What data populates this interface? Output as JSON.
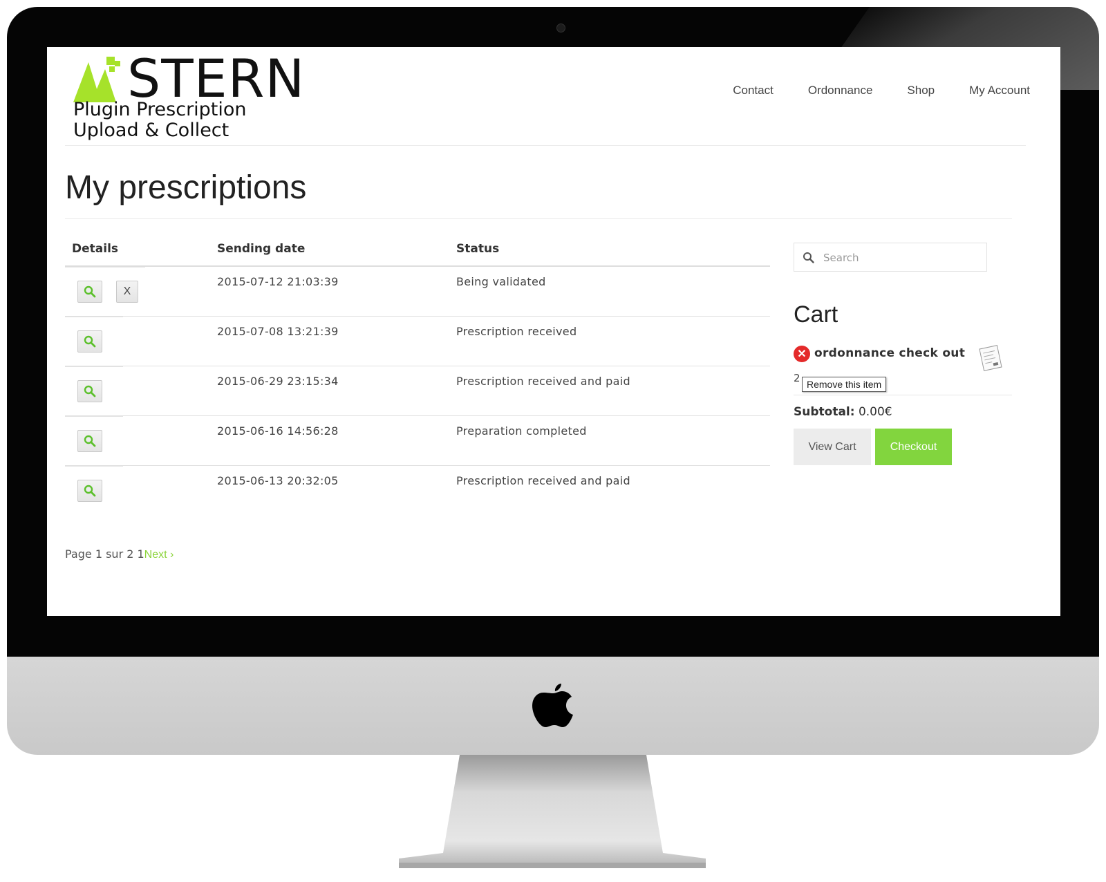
{
  "site": {
    "logo_word": "STERN",
    "logo_sub_line1": "Plugin Prescription",
    "logo_sub_line2": "Upload & Collect",
    "accent": "#8cd43c",
    "logo_green": "#a6e22a"
  },
  "nav": {
    "items": [
      "Contact",
      "Ordonnance",
      "Shop",
      "My Account"
    ]
  },
  "page": {
    "title": "My prescriptions"
  },
  "table": {
    "headers": {
      "details": "Details",
      "date": "Sending date",
      "status": "Status"
    },
    "view_icon": "search-icon",
    "delete_label": "X",
    "rows": [
      {
        "date": "2015-07-12 21:03:39",
        "status": "Being validated",
        "deletable": true
      },
      {
        "date": "2015-07-08 13:21:39",
        "status": "Prescription received",
        "deletable": false
      },
      {
        "date": "2015-06-29 23:15:34",
        "status": "Prescription received and paid",
        "deletable": false
      },
      {
        "date": "2015-06-16 14:56:28",
        "status": "Preparation completed",
        "deletable": false
      },
      {
        "date": "2015-06-13 20:32:05",
        "status": "Prescription received and paid",
        "deletable": false
      }
    ]
  },
  "pager": {
    "text": "Page 1 sur 2 1",
    "next": "Next ›"
  },
  "sidebar": {
    "search_placeholder": "Search",
    "cart_title": "Cart",
    "item_name": "ordonnance check out",
    "item_qty": "2",
    "remove_tooltip": "Remove this item",
    "subtotal_label": "Subtotal:",
    "subtotal_value": "0.00€",
    "view_cart": "View Cart",
    "checkout": "Checkout",
    "remove_color": "#e42a2a",
    "checkout_color": "#82d53e"
  }
}
